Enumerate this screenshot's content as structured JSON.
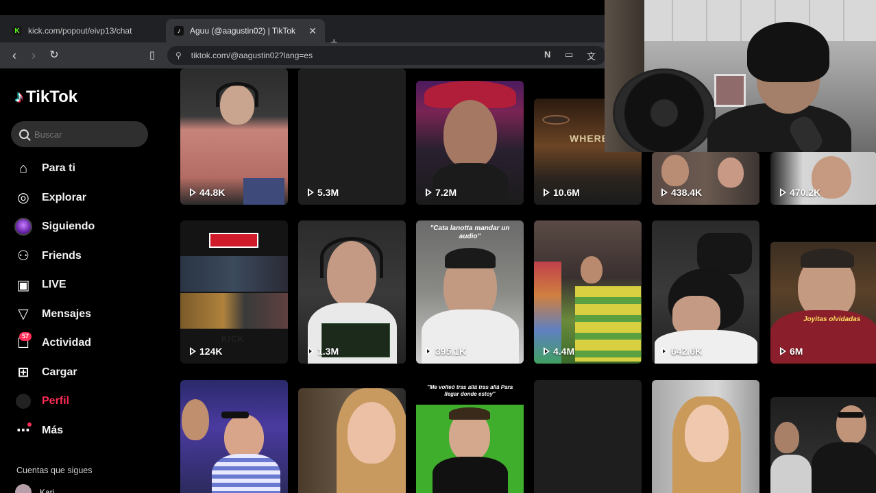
{
  "browser": {
    "tabs": [
      {
        "label": "kick.com/popout/eivp13/chat",
        "icon": "kick-logo-icon",
        "active": false
      },
      {
        "label": "Aguu (@aagustin02) | TikTok",
        "icon": "tiktok-logo-icon",
        "active": true
      }
    ],
    "new_tab_label": "+",
    "url": "tiktok.com/@aagustin02?lang=es"
  },
  "tiktok": {
    "logo_text": "TikTok",
    "search_placeholder": "Buscar",
    "nav": [
      {
        "label": "Para ti",
        "icon": "home-icon"
      },
      {
        "label": "Explorar",
        "icon": "compass-icon"
      },
      {
        "label": "Siguiendo",
        "icon": "following-avatar-icon"
      },
      {
        "label": "Friends",
        "icon": "friends-icon"
      },
      {
        "label": "LIVE",
        "icon": "live-tv-icon"
      },
      {
        "label": "Mensajes",
        "icon": "send-icon"
      },
      {
        "label": "Actividad",
        "icon": "activity-icon",
        "badge": "57"
      },
      {
        "label": "Cargar",
        "icon": "upload-plus-icon"
      },
      {
        "label": "Perfil",
        "icon": "profile-avatar-icon"
      },
      {
        "label": "Más",
        "icon": "more-dots-icon"
      }
    ],
    "following_title": "Cuentas que sigues",
    "following_accounts": [
      {
        "name": "Kari"
      }
    ],
    "accent_color": "#fe2c55"
  },
  "videos": [
    {
      "views": "44.8K"
    },
    {
      "views": "5.3M"
    },
    {
      "views": "7.2M"
    },
    {
      "views": "10.6M",
      "overlay_text": "WHERE"
    },
    {
      "views": "438.4K"
    },
    {
      "views": "470.2K"
    },
    {
      "views": "124K",
      "overlay_text": "KICK"
    },
    {
      "views": "1.3M"
    },
    {
      "views": "395.1K",
      "caption": "\"Cata lanotta mandar un audio\""
    },
    {
      "views": "4.4M"
    },
    {
      "views": "642.6K"
    },
    {
      "views": "6M",
      "overlay_text": "Joyitas olvidadas"
    },
    {
      "views": ""
    },
    {
      "views": ""
    },
    {
      "views": "",
      "caption": "\"Me volteó tras allá tras allá Para llegar donde estoy\""
    },
    {
      "views": ""
    },
    {
      "views": ""
    },
    {
      "views": ""
    }
  ]
}
